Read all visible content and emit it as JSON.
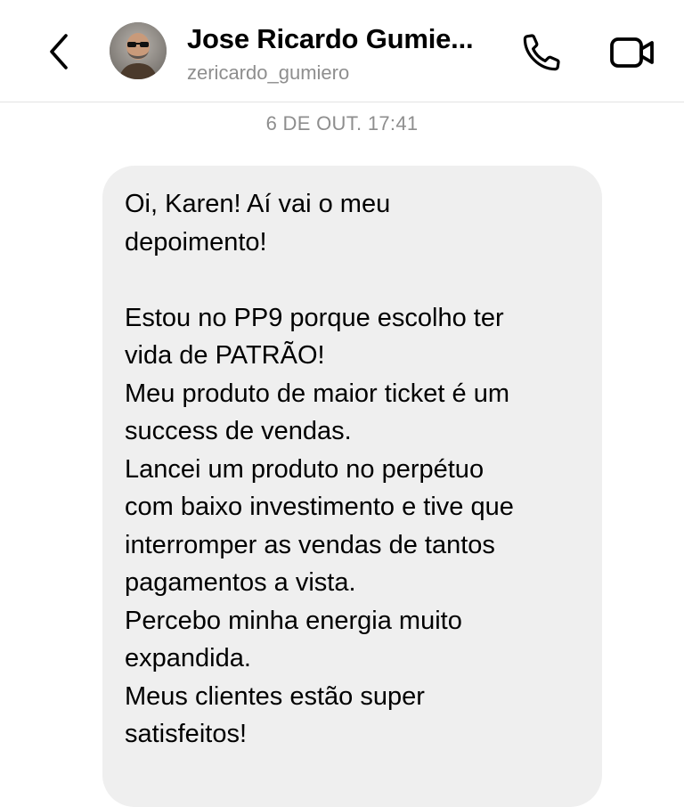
{
  "header": {
    "contact_name": "Jose Ricardo Gumie...",
    "contact_handle": "zericardo_gumiero",
    "back_icon": "chevron-left-icon",
    "call_icon": "phone-icon",
    "video_icon": "video-camera-icon"
  },
  "thread": {
    "timestamp": "6 DE OUT. 17:41"
  },
  "message": {
    "lines": [
      "Oi, Karen! Aí vai o meu",
      "depoimento!",
      "",
      "Estou no PP9 porque escolho ter",
      "vida de PATRÃO!",
      "Meu produto de maior ticket é um",
      "success de vendas.",
      "Lancei um produto no perpétuo",
      "com baixo investimento e tive que",
      "interromper as vendas de tantos",
      "pagamentos a vista.",
      "Percebo minha energia muito",
      "expandida.",
      "Meus clientes estão super",
      "satisfeitos!"
    ]
  },
  "colors": {
    "bubble_background": "#efefef",
    "secondary_text": "#8e8e8e",
    "primary_text": "#000000"
  }
}
